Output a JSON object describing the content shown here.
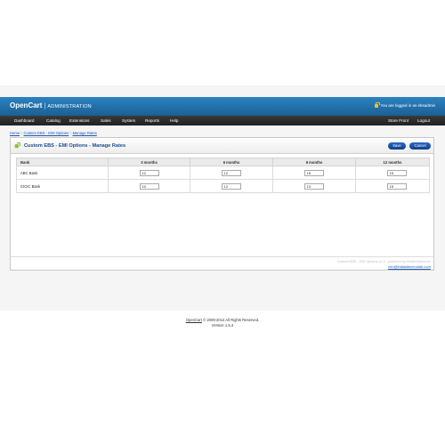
{
  "header": {
    "brand": "OpenCart",
    "section": "ADMINISTRATION",
    "login_text": "You are logged in as ",
    "username": "ebsadmin"
  },
  "menu": {
    "left": [
      "Dashboard",
      "Catalog",
      "Extensions",
      "Sales",
      "System",
      "Reports",
      "Help"
    ],
    "store_front": "Store Front",
    "logout": "Logout"
  },
  "breadcrumb": [
    "Home",
    "Custom EBS - EMI Options",
    "Manage Rates"
  ],
  "breadcrumb_sep": "::",
  "box": {
    "title": "Custom EBS - EMI Options - Manage Rates",
    "save": "Save",
    "cancel": "Cancel"
  },
  "table": {
    "headers": [
      "Bank",
      "3 months",
      "6 months",
      "9 months",
      "12 months"
    ],
    "rows": [
      {
        "bank": "ABC Bank",
        "values": [
          "12",
          "12",
          "15",
          "15"
        ]
      },
      {
        "bank": "CICIC Bank",
        "values": [
          "10",
          "12",
          "13",
          "15"
        ]
      }
    ]
  },
  "module_footer": {
    "credit": "Custom EBS - EMI Options v1.0 - powered by Nekta Webstore",
    "email": "info@indiasitechnolab.com"
  },
  "footer": {
    "link": "OpenCart",
    "copyright": " © 2009-2014 All Rights Reserved.",
    "version": "Version 1.5.4"
  },
  "colors": {
    "header": "#1f6aa5",
    "menu": "#2a2a2a",
    "title": "#1b4b8a",
    "button": "#1c55a8"
  }
}
